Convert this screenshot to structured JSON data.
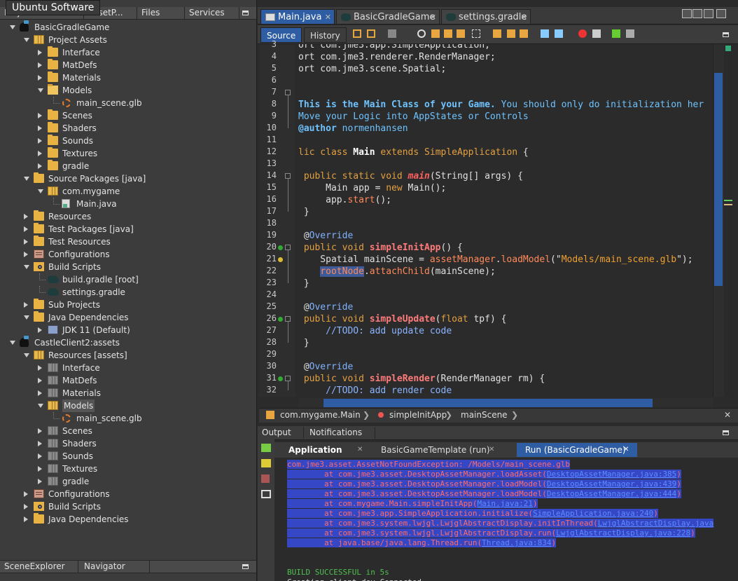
{
  "tooltip": "Ubuntu Software",
  "left_tabs": [
    "Projects",
    "AssetP...",
    "Files",
    "Services"
  ],
  "tree": [
    {
      "depth": 0,
      "toggle": "open",
      "icon": "proj",
      "label": "BasicGradleGame"
    },
    {
      "depth": 1,
      "toggle": "open",
      "icon": "grid-y",
      "label": "Project Assets"
    },
    {
      "depth": 2,
      "toggle": "closed",
      "icon": "folder",
      "label": "Interface"
    },
    {
      "depth": 2,
      "toggle": "closed",
      "icon": "folder",
      "label": "MatDefs"
    },
    {
      "depth": 2,
      "toggle": "closed",
      "icon": "folder",
      "label": "Materials"
    },
    {
      "depth": 2,
      "toggle": "open",
      "icon": "folder-open",
      "label": "Models"
    },
    {
      "depth": 3,
      "toggle": "none",
      "icon": "glb",
      "label": "main_scene.glb"
    },
    {
      "depth": 2,
      "toggle": "closed",
      "icon": "folder",
      "label": "Scenes"
    },
    {
      "depth": 2,
      "toggle": "closed",
      "icon": "folder",
      "label": "Shaders"
    },
    {
      "depth": 2,
      "toggle": "closed",
      "icon": "folder",
      "label": "Sounds"
    },
    {
      "depth": 2,
      "toggle": "closed",
      "icon": "folder",
      "label": "Textures"
    },
    {
      "depth": 2,
      "toggle": "closed",
      "icon": "folder",
      "label": "gradle"
    },
    {
      "depth": 1,
      "toggle": "open",
      "icon": "folder",
      "label": "Source Packages [java]"
    },
    {
      "depth": 2,
      "toggle": "open",
      "icon": "grid-y",
      "label": "com.mygame"
    },
    {
      "depth": 3,
      "toggle": "none",
      "icon": "file",
      "label": "Main.java"
    },
    {
      "depth": 1,
      "toggle": "closed",
      "icon": "folder",
      "label": "Resources"
    },
    {
      "depth": 1,
      "toggle": "closed",
      "icon": "folder",
      "label": "Test Packages [java]"
    },
    {
      "depth": 1,
      "toggle": "closed",
      "icon": "folder",
      "label": "Test Resources"
    },
    {
      "depth": 1,
      "toggle": "closed",
      "icon": "cfg",
      "label": "Configurations"
    },
    {
      "depth": 1,
      "toggle": "open",
      "icon": "build",
      "label": "Build Scripts"
    },
    {
      "depth": 2,
      "toggle": "none",
      "icon": "elephant",
      "label": "build.gradle [root]"
    },
    {
      "depth": 2,
      "toggle": "none",
      "icon": "elephant",
      "label": "settings.gradle"
    },
    {
      "depth": 1,
      "toggle": "closed",
      "icon": "folder",
      "label": "Sub Projects"
    },
    {
      "depth": 1,
      "toggle": "open",
      "icon": "folder",
      "label": "Java Dependencies"
    },
    {
      "depth": 2,
      "toggle": "closed",
      "icon": "jdk",
      "label": "JDK 11 (Default)"
    },
    {
      "depth": 0,
      "toggle": "open",
      "icon": "proj",
      "label": "CastleClient2:assets"
    },
    {
      "depth": 1,
      "toggle": "open",
      "icon": "grid-y",
      "label": "Resources [assets]"
    },
    {
      "depth": 2,
      "toggle": "closed",
      "icon": "grid",
      "label": "Interface"
    },
    {
      "depth": 2,
      "toggle": "closed",
      "icon": "grid",
      "label": "MatDefs"
    },
    {
      "depth": 2,
      "toggle": "closed",
      "icon": "grid",
      "label": "Materials"
    },
    {
      "depth": 2,
      "toggle": "open",
      "icon": "grid-y",
      "label": "Models",
      "selected": true
    },
    {
      "depth": 3,
      "toggle": "none",
      "icon": "glb",
      "label": "main_scene.glb"
    },
    {
      "depth": 2,
      "toggle": "closed",
      "icon": "grid",
      "label": "Scenes"
    },
    {
      "depth": 2,
      "toggle": "closed",
      "icon": "grid",
      "label": "Shaders"
    },
    {
      "depth": 2,
      "toggle": "closed",
      "icon": "grid",
      "label": "Sounds"
    },
    {
      "depth": 2,
      "toggle": "closed",
      "icon": "grid",
      "label": "Textures"
    },
    {
      "depth": 2,
      "toggle": "closed",
      "icon": "grid",
      "label": "gradle"
    },
    {
      "depth": 1,
      "toggle": "closed",
      "icon": "cfg",
      "label": "Configurations"
    },
    {
      "depth": 1,
      "toggle": "closed",
      "icon": "build",
      "label": "Build Scripts"
    },
    {
      "depth": 1,
      "toggle": "closed",
      "icon": "folder",
      "label": "Java Dependencies"
    }
  ],
  "left_bottom_tabs": [
    "SceneExplorer",
    "Navigator"
  ],
  "editor_tabs": [
    {
      "label": "Main.java",
      "active": true
    },
    {
      "label": "BasicGradleGame",
      "active": false
    },
    {
      "label": "settings.gradle",
      "active": false
    }
  ],
  "view_tabs": [
    "Source",
    "History"
  ],
  "code_lines": [
    {
      "n": "3",
      "segs": [
        [
          "",
          "ort com.jme3.app.SimpleApplication;"
        ]
      ]
    },
    {
      "n": "4",
      "segs": [
        [
          "",
          "ort com.jme3.renderer.RenderManager;"
        ]
      ]
    },
    {
      "n": "5",
      "segs": [
        [
          "",
          "ort com.jme3.scene.Spatial;"
        ]
      ]
    },
    {
      "n": "6",
      "segs": []
    },
    {
      "n": "7",
      "segs": []
    },
    {
      "n": "8",
      "segs": [
        [
          "docb",
          "This is the Main Class of your Game."
        ],
        [
          "doc",
          " You should only do initialization her"
        ]
      ]
    },
    {
      "n": "9",
      "segs": [
        [
          "doc",
          "Move your Logic into AppStates or Controls"
        ]
      ]
    },
    {
      "n": "10",
      "segs": [
        [
          "docb",
          "@author"
        ],
        [
          "doc",
          " normenhansen"
        ]
      ]
    },
    {
      "n": "11",
      "segs": []
    },
    {
      "n": "12",
      "segs": [
        [
          "kw",
          "lic class "
        ],
        [
          "bold",
          "Main"
        ],
        [
          "kw",
          " extends "
        ],
        [
          "cls",
          "SimpleApplication"
        ],
        [
          "",
          " {"
        ]
      ]
    },
    {
      "n": "13",
      "segs": []
    },
    {
      "n": "14",
      "segs": [
        [
          "kw",
          " public static void "
        ],
        [
          "fnit",
          "main"
        ],
        [
          "",
          "(String[] args) {"
        ]
      ]
    },
    {
      "n": "15",
      "segs": [
        [
          "",
          "     Main app = "
        ],
        [
          "kw",
          "new "
        ],
        [
          "",
          "Main();"
        ]
      ]
    },
    {
      "n": "16",
      "segs": [
        [
          "",
          "     app."
        ],
        [
          "call",
          "start"
        ],
        [
          "",
          "();"
        ]
      ]
    },
    {
      "n": "17",
      "segs": [
        [
          "",
          " }"
        ]
      ]
    },
    {
      "n": "18",
      "segs": []
    },
    {
      "n": "19",
      "segs": [
        [
          "",
          " @"
        ],
        [
          "ann",
          "Override"
        ]
      ]
    },
    {
      "n": "20",
      "segs": [
        [
          "kw",
          " public void "
        ],
        [
          "fn",
          "simpleInitApp"
        ],
        [
          "",
          "() {"
        ]
      ]
    },
    {
      "n": "21",
      "segs": [
        [
          "",
          "    Spatial mainScene = "
        ],
        [
          "fld",
          "assetManager"
        ],
        [
          "",
          "."
        ],
        [
          "call",
          "loadModel"
        ],
        [
          "",
          "(\""
        ],
        [
          "str",
          "Models/main_scene.glb"
        ],
        [
          "",
          "\");"
        ]
      ]
    },
    {
      "n": "22",
      "segs": [
        [
          "",
          "    "
        ],
        [
          "fld hlblue",
          "rootNode"
        ],
        [
          "",
          "."
        ],
        [
          "call",
          "attachChild"
        ],
        [
          "",
          "(mainScene);"
        ]
      ]
    },
    {
      "n": "23",
      "segs": [
        [
          "",
          " }"
        ]
      ]
    },
    {
      "n": "24",
      "segs": []
    },
    {
      "n": "25",
      "segs": [
        [
          "",
          " @"
        ],
        [
          "ann",
          "Override"
        ]
      ]
    },
    {
      "n": "26",
      "segs": [
        [
          "kw",
          " public void "
        ],
        [
          "fn",
          "simpleUpdate"
        ],
        [
          "",
          "("
        ],
        [
          "kw",
          "float "
        ],
        [
          "",
          "tpf) {"
        ]
      ]
    },
    {
      "n": "27",
      "segs": [
        [
          "cmt",
          "     //TODO: add update code"
        ]
      ]
    },
    {
      "n": "28",
      "segs": [
        [
          "",
          " }"
        ]
      ]
    },
    {
      "n": "29",
      "segs": []
    },
    {
      "n": "30",
      "segs": [
        [
          "",
          " @"
        ],
        [
          "ann",
          "Override"
        ]
      ]
    },
    {
      "n": "31",
      "segs": [
        [
          "kw",
          " public void "
        ],
        [
          "fn",
          "simpleRender"
        ],
        [
          "",
          "(RenderManager rm) {"
        ]
      ]
    },
    {
      "n": "32",
      "segs": [
        [
          "cmt",
          "     //TODO: add render code"
        ]
      ]
    }
  ],
  "breadcrumb": [
    "com.mygame.Main",
    "simpleInitApp",
    "mainScene"
  ],
  "output_tabs": [
    "Output",
    "Notifications"
  ],
  "run_tabs": [
    {
      "label": "Application",
      "style": "active"
    },
    {
      "label": "BasicGameTemplate (run)",
      "style": ""
    },
    {
      "label": "Run (BasicGradleGame)",
      "style": "blue"
    }
  ],
  "output_lines": [
    {
      "segs": [
        [
          "errsel",
          "com.jme3.asset.AssetNotFoundException: /Models/main_scene.glb"
        ]
      ]
    },
    {
      "segs": [
        [
          "errsel",
          "        at com.jme3.asset.DesktopAssetManager.loadAsset("
        ],
        [
          "errsel lnk",
          "DesktopAssetManager.java:385"
        ],
        [
          "errsel",
          ")"
        ]
      ]
    },
    {
      "segs": [
        [
          "errsel",
          "        at com.jme3.asset.DesktopAssetManager.loadModel("
        ],
        [
          "errsel lnk",
          "DesktopAssetManager.java:439"
        ],
        [
          "errsel",
          ")"
        ]
      ]
    },
    {
      "segs": [
        [
          "errsel",
          "        at com.jme3.asset.DesktopAssetManager.loadModel("
        ],
        [
          "errsel lnk",
          "DesktopAssetManager.java:444"
        ],
        [
          "errsel",
          ")"
        ]
      ]
    },
    {
      "segs": [
        [
          "errsel",
          "        at com.mygame.Main.simpleInitApp("
        ],
        [
          "errsel lnk",
          "Main.java:21"
        ],
        [
          "errsel",
          ")"
        ]
      ]
    },
    {
      "segs": [
        [
          "errsel",
          "        at com.jme3.app.SimpleApplication.initialize("
        ],
        [
          "errsel lnk",
          "SimpleApplication.java:240"
        ],
        [
          "errsel",
          ")"
        ]
      ]
    },
    {
      "segs": [
        [
          "errsel",
          "        at com.jme3.system.lwjgl.LwjglAbstractDisplay.initInThread("
        ],
        [
          "errsel lnk",
          "LwjglAbstractDisplay.java"
        ]
      ]
    },
    {
      "segs": [
        [
          "errsel",
          "        at com.jme3.system.lwjgl.LwjglAbstractDisplay.run("
        ],
        [
          "errsel lnk",
          "LwjglAbstractDisplay.java:228"
        ],
        [
          "errsel",
          ")"
        ]
      ]
    },
    {
      "segs": [
        [
          "errsel",
          "        at java.base/java.lang.Thread.run("
        ],
        [
          "errsel lnk",
          "Thread.java:834"
        ],
        [
          "errsel",
          ")"
        ]
      ]
    },
    {
      "segs": []
    },
    {
      "segs": []
    },
    {
      "segs": [
        [
          "ok",
          "BUILD SUCCESSFUL in 5s"
        ]
      ]
    },
    {
      "segs": [
        [
          "",
          "Creating client_dev_Connected"
        ]
      ]
    }
  ],
  "colors": {
    "accent": "#2f5da3",
    "error": "#ff6b6b",
    "success": "#4fc04f"
  }
}
